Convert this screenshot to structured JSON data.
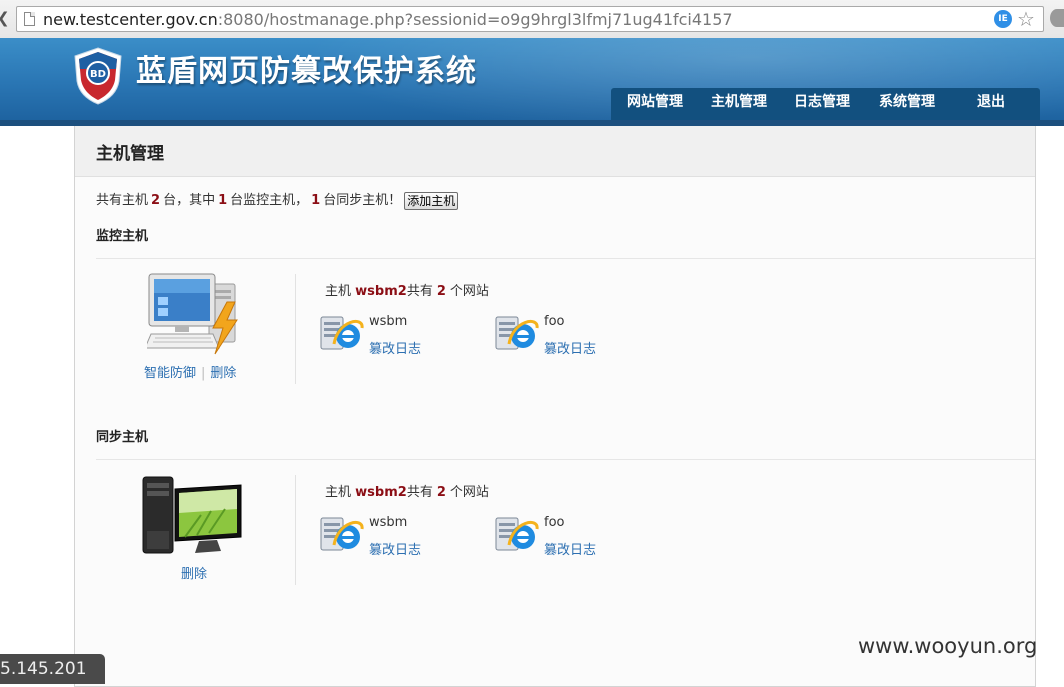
{
  "browser": {
    "url_host": "new.testcenter.gov.cn",
    "url_rest": ":8080/hostmanage.php?sessionid=o9g9hrgl3lfmj71ug41fci4157",
    "ext_icon_label": "IE",
    "star_icon": "bookmark-star-icon"
  },
  "header": {
    "logo_text": "BD",
    "title": "蓝盾网页防篡改保护系统",
    "nav": [
      "网站管理",
      "主机管理",
      "日志管理",
      "系统管理",
      "退出"
    ]
  },
  "main": {
    "title": "主机管理",
    "summary": {
      "prefix": "共有主机",
      "total": "2",
      "mid1": "台，其中",
      "monitor_count": "1",
      "mid2": "台监控主机，",
      "sync_count": "1",
      "suffix": "台同步主机！",
      "add_button": "添加主机"
    },
    "monitor_section": {
      "title": "监控主机",
      "actions": [
        "智能防御",
        "删除"
      ],
      "host_label": "主机",
      "host_name": "wsbm2",
      "has_label": "共有",
      "site_count": "2",
      "site_unit": "个网站",
      "sites": [
        {
          "name": "wsbm",
          "log_link": "篡改日志"
        },
        {
          "name": "foo",
          "log_link": "篡改日志"
        }
      ]
    },
    "sync_section": {
      "title": "同步主机",
      "actions": [
        "删除"
      ],
      "host_label": "主机",
      "host_name": "wsbm2",
      "has_label": "共有",
      "site_count": "2",
      "site_unit": "个网站",
      "sites": [
        {
          "name": "wsbm",
          "log_link": "篡改日志"
        },
        {
          "name": "foo",
          "log_link": "篡改日志"
        }
      ]
    }
  },
  "overlay": {
    "ip_fragment": "5.145.201",
    "watermark": "www.wooyun.org"
  },
  "colors": {
    "header_blue": "#2a76b4",
    "nav_bg": "#12507f",
    "highlight_red": "#8b0e15",
    "link_blue": "#2c6fb1"
  }
}
